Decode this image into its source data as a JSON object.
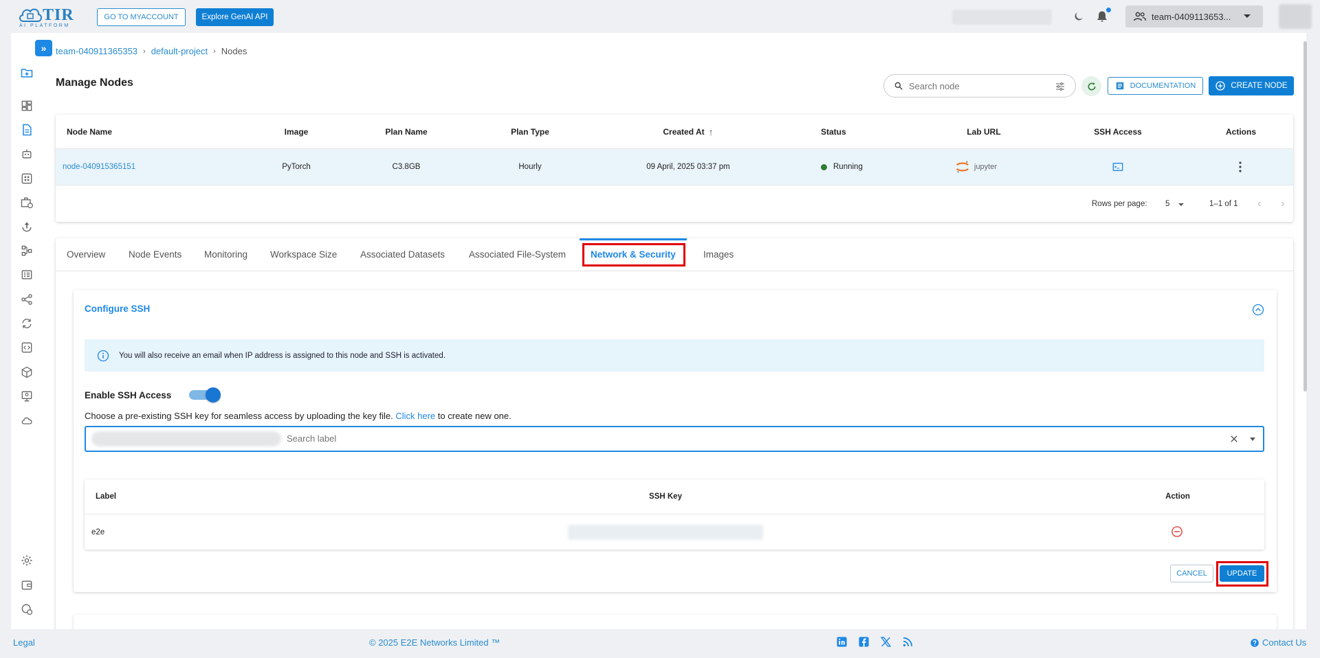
{
  "app": {
    "brand": "TIR",
    "brand_sub": "AI PLATFORM"
  },
  "topbar": {
    "myaccount_label": "GO TO MYACCOUNT",
    "genai_label": "Explore GenAI API",
    "team_label": "team-0409113653..."
  },
  "breadcrumb": {
    "team": "team-040911365353",
    "project": "default-project",
    "current": "Nodes",
    "separator": "›"
  },
  "page": {
    "title": "Manage Nodes",
    "search_placeholder": "Search node",
    "documentation_label": "DOCUMENTATION",
    "create_label": "CREATE NODE"
  },
  "nodes_table": {
    "columns": [
      "Node Name",
      "Image",
      "Plan Name",
      "Plan Type",
      "Created At",
      "Status",
      "Lab URL",
      "SSH Access",
      "Actions"
    ],
    "sort_indicator": "↑",
    "rows": [
      {
        "node_name": "node-040915365151",
        "image": "PyTorch",
        "plan_name": "C3.8GB",
        "plan_type": "Hourly",
        "created_at": "09 April, 2025 03:37 pm",
        "status": "Running",
        "lab_url": "jupyter"
      }
    ],
    "rows_per_page_label": "Rows per page:",
    "rows_per_page": "5",
    "range": "1–1 of 1",
    "prev": "‹",
    "next": "›"
  },
  "tabs": [
    {
      "label": "Overview"
    },
    {
      "label": "Node Events"
    },
    {
      "label": "Monitoring"
    },
    {
      "label": "Workspace Size"
    },
    {
      "label": "Associated Datasets"
    },
    {
      "label": "Associated File-System"
    },
    {
      "label": "Network & Security",
      "active": true
    },
    {
      "label": "Images"
    }
  ],
  "ssh": {
    "title": "Configure SSH",
    "info": "You will also receive an email when IP address is assigned to this node and SSH is activated.",
    "enable_label": "Enable SSH Access",
    "enabled": true,
    "choose_text": "Choose a pre-existing SSH key for seamless access by uploading the key file.",
    "click_here": "Click here",
    "create_text": "to create new one.",
    "search_placeholder": "Search label",
    "table": {
      "columns": [
        "Label",
        "SSH Key",
        "Action"
      ],
      "rows": [
        {
          "label": "e2e"
        }
      ]
    },
    "cancel_label": "CANCEL",
    "update_label": "UPDATE"
  },
  "footer": {
    "legal": "Legal",
    "copyright": "© 2025 E2E Networks Limited ™",
    "social": [
      "linkedin-icon",
      "facebook-icon",
      "x-icon",
      "rss-icon"
    ],
    "contact": "Contact Us"
  },
  "colors": {
    "accent": "#1e88e5",
    "primary_button": "#0f7fd4",
    "highlight": "#e00000",
    "running": "#2e7d32"
  }
}
